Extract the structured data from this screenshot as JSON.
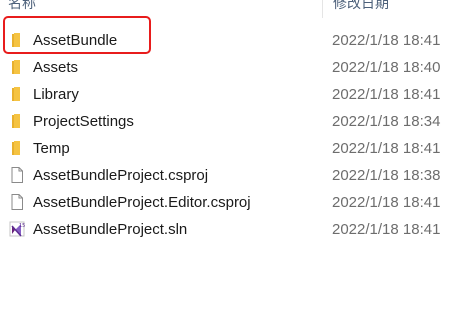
{
  "header": {
    "name_label": "名称",
    "date_label": "修改日期"
  },
  "files": [
    {
      "name": "AssetBundle",
      "modified": "2022/1/18 18:41",
      "icon": "folder-icon",
      "highlighted": true
    },
    {
      "name": "Assets",
      "modified": "2022/1/18 18:40",
      "icon": "folder-icon"
    },
    {
      "name": "Library",
      "modified": "2022/1/18 18:41",
      "icon": "folder-icon"
    },
    {
      "name": "ProjectSettings",
      "modified": "2022/1/18 18:34",
      "icon": "folder-icon"
    },
    {
      "name": "Temp",
      "modified": "2022/1/18 18:41",
      "icon": "folder-icon"
    },
    {
      "name": "AssetBundleProject.csproj",
      "modified": "2022/1/18 18:38",
      "icon": "file-icon"
    },
    {
      "name": "AssetBundleProject.Editor.csproj",
      "modified": "2022/1/18 18:41",
      "icon": "file-icon"
    },
    {
      "name": "AssetBundleProject.sln",
      "modified": "2022/1/18 18:41",
      "icon": "visual-studio-solution-icon"
    }
  ],
  "colors": {
    "highlight_border": "#e81c1c",
    "folder": "#f5c342",
    "header_text": "#4c607a",
    "date_text": "#6d6d6d"
  }
}
